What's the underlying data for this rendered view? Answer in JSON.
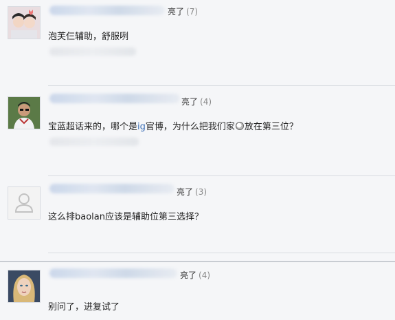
{
  "comments": [
    {
      "liked_label": "亮了",
      "like_count": "(7)",
      "text": "泡芙仨辅助，舒服咧"
    },
    {
      "liked_label": "亮了",
      "like_count": "(4)",
      "text_part1": "宝蓝超话来的，哪个是",
      "text_highlight": "ig",
      "text_part2": "官博，为什么把我们家",
      "text_part3": "放在第三位？"
    },
    {
      "liked_label": "亮了",
      "like_count": "(3)",
      "text": "这么排baolan应该是辅助位第三选择？"
    },
    {
      "liked_label": "亮了",
      "like_count": "(4)",
      "text": "别问了，进复试了"
    }
  ]
}
